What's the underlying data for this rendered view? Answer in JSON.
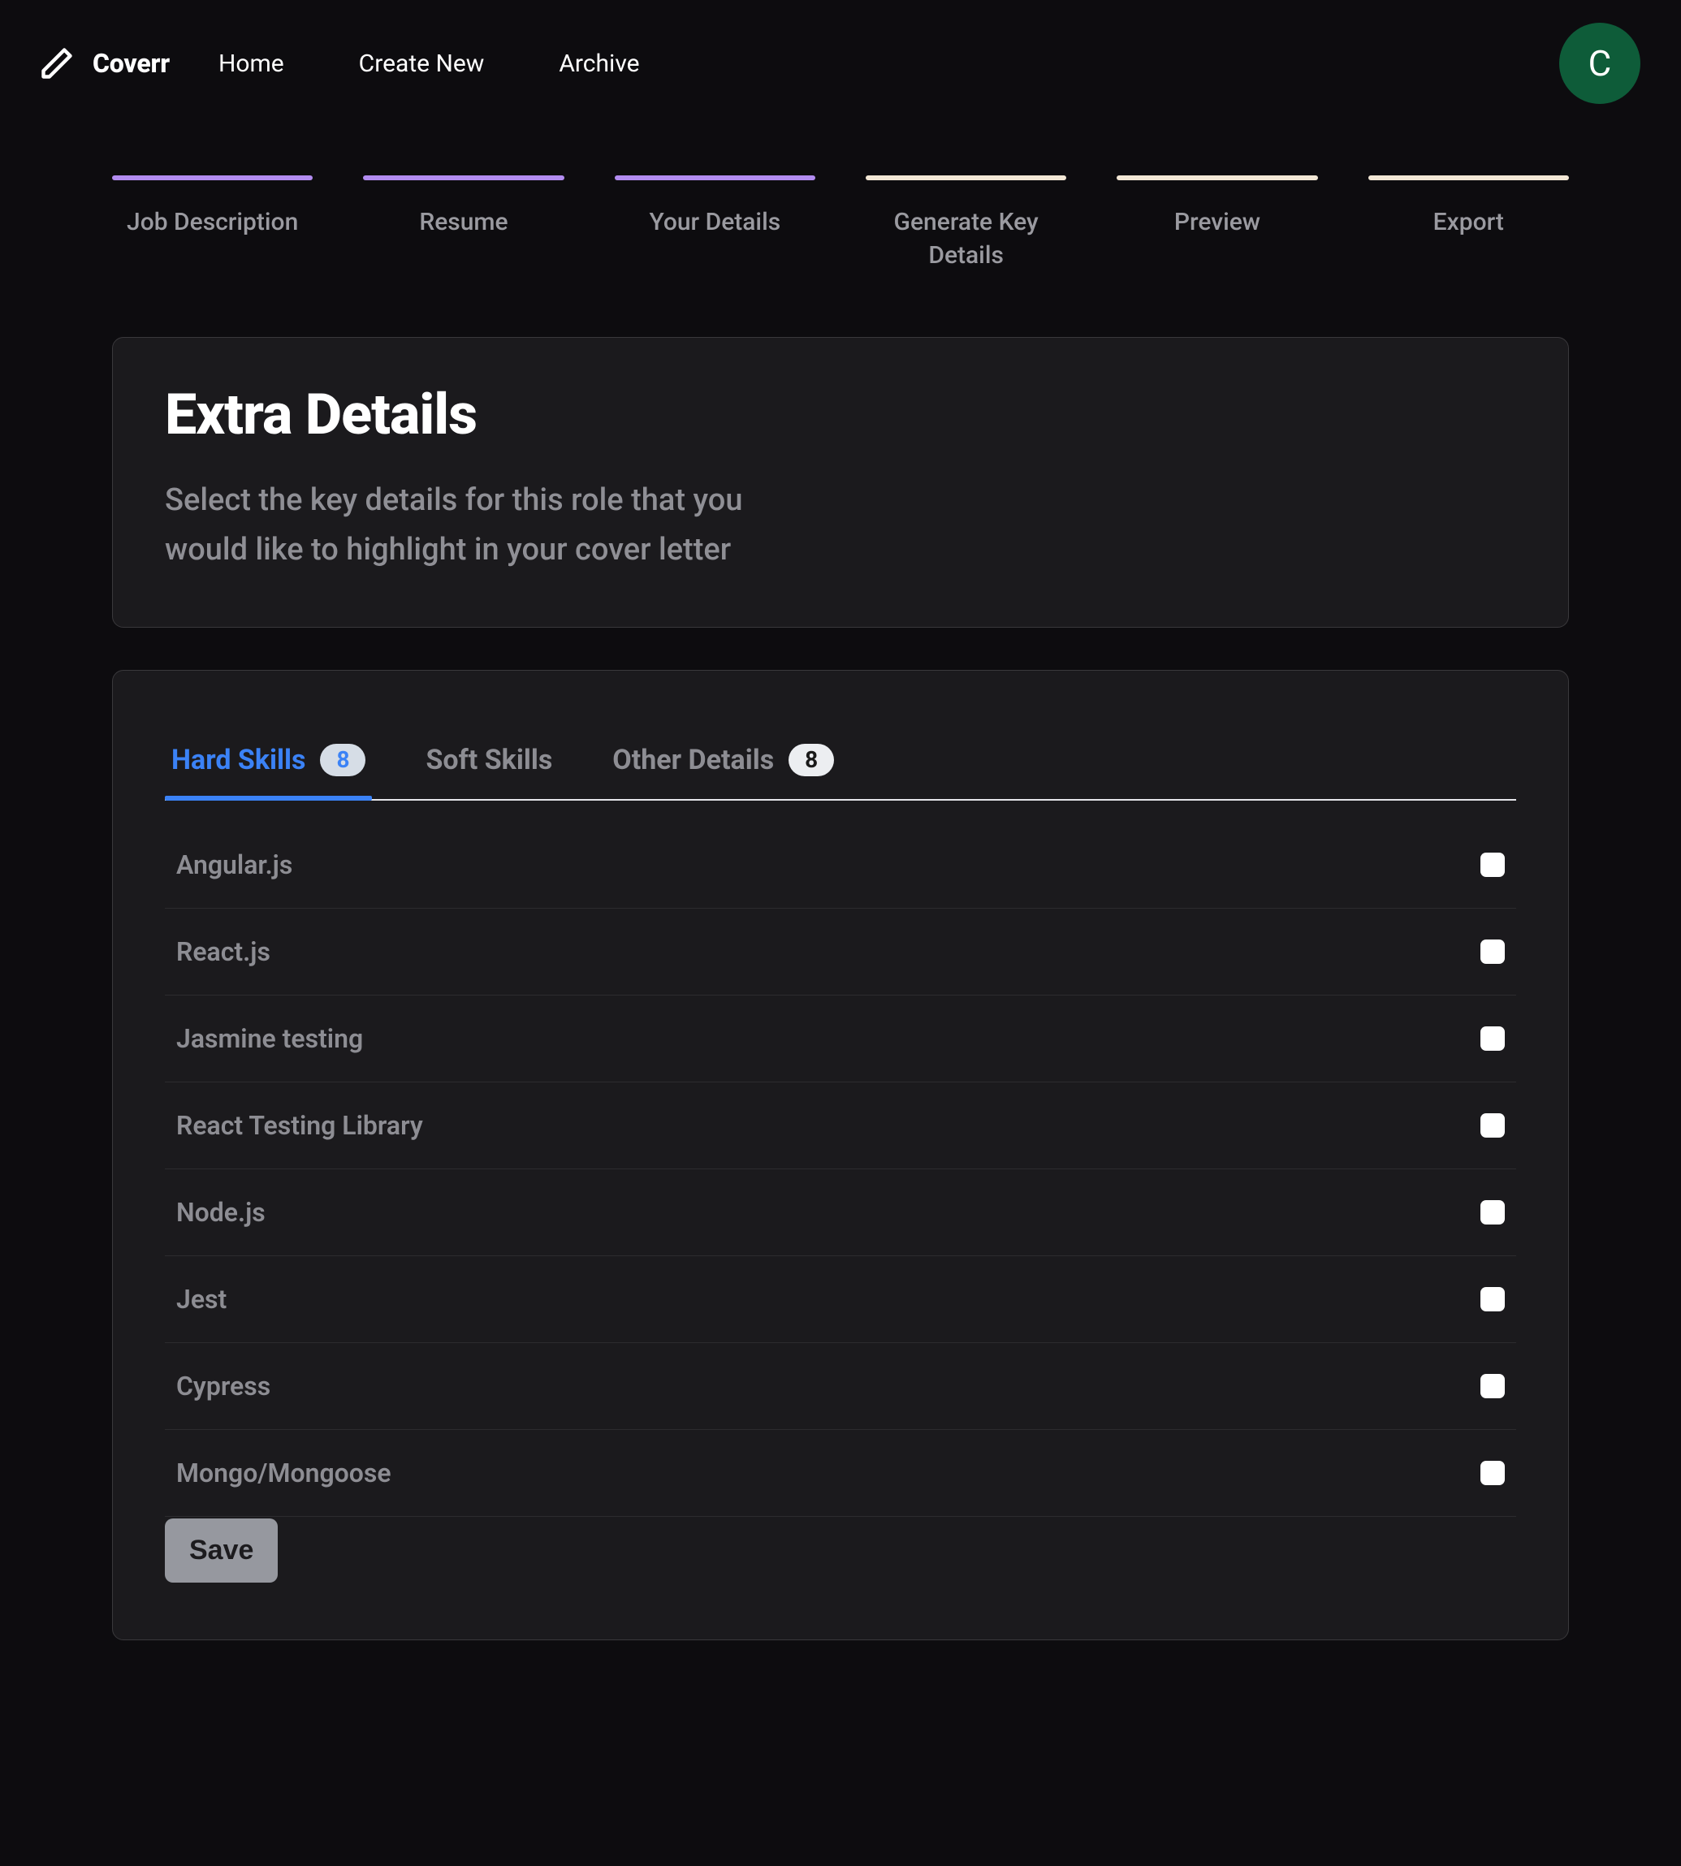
{
  "brand": {
    "name": "Coverr"
  },
  "nav": {
    "home": "Home",
    "create": "Create New",
    "archive": "Archive"
  },
  "avatar": {
    "initial": "C"
  },
  "stepper": {
    "steps": [
      {
        "label": "Job Description",
        "state": "done"
      },
      {
        "label": "Resume",
        "state": "done"
      },
      {
        "label": "Your Details",
        "state": "done"
      },
      {
        "label": "Generate Key Details",
        "state": "pending"
      },
      {
        "label": "Preview",
        "state": "pending"
      },
      {
        "label": "Export",
        "state": "pending"
      }
    ]
  },
  "intro": {
    "title": "Extra Details",
    "subtitle": "Select the key details for this role that you would like to highlight in your cover letter"
  },
  "tabs": {
    "hard": {
      "label": "Hard Skills",
      "count": "8",
      "active": true
    },
    "soft": {
      "label": "Soft Skills"
    },
    "other": {
      "label": "Other Details",
      "count": "8"
    }
  },
  "skills": [
    {
      "name": "Angular.js",
      "checked": false
    },
    {
      "name": "React.js",
      "checked": false
    },
    {
      "name": "Jasmine testing",
      "checked": false
    },
    {
      "name": "React Testing Library",
      "checked": false
    },
    {
      "name": "Node.js",
      "checked": false
    },
    {
      "name": "Jest",
      "checked": false
    },
    {
      "name": "Cypress",
      "checked": false
    },
    {
      "name": "Mongo/Mongoose",
      "checked": false
    }
  ],
  "actions": {
    "save": "Save"
  }
}
